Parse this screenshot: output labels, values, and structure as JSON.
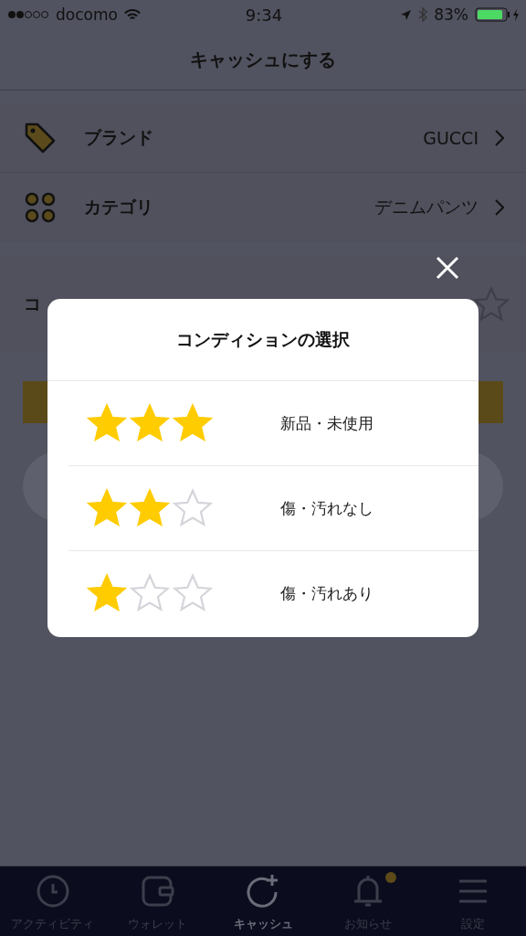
{
  "status_bar": {
    "carrier": "docomo",
    "time": "9:34",
    "battery": "83%"
  },
  "nav": {
    "title": "キャッシュにする"
  },
  "rows": [
    {
      "kind": "tag",
      "label": "ブランド",
      "value": "GUCCI"
    },
    {
      "kind": "grid",
      "label": "カテゴリ",
      "value": "デニムパンツ"
    }
  ],
  "condition_row": {
    "label": "コ"
  },
  "modal": {
    "title": "コンディションの選択",
    "options": [
      {
        "stars": 3,
        "label": "新品・未使用"
      },
      {
        "stars": 2,
        "label": "傷・汚れなし"
      },
      {
        "stars": 1,
        "label": "傷・汚れあり"
      }
    ]
  },
  "tabs": [
    {
      "kind": "clock",
      "label": "アクティビティ",
      "selected": false,
      "badge": false
    },
    {
      "kind": "wallet",
      "label": "ウォレット",
      "selected": false,
      "badge": false
    },
    {
      "kind": "cash",
      "label": "キャッシュ",
      "selected": true,
      "badge": false
    },
    {
      "kind": "bell",
      "label": "お知らせ",
      "selected": false,
      "badge": true
    },
    {
      "kind": "menu",
      "label": "設定",
      "selected": false,
      "badge": false
    }
  ]
}
